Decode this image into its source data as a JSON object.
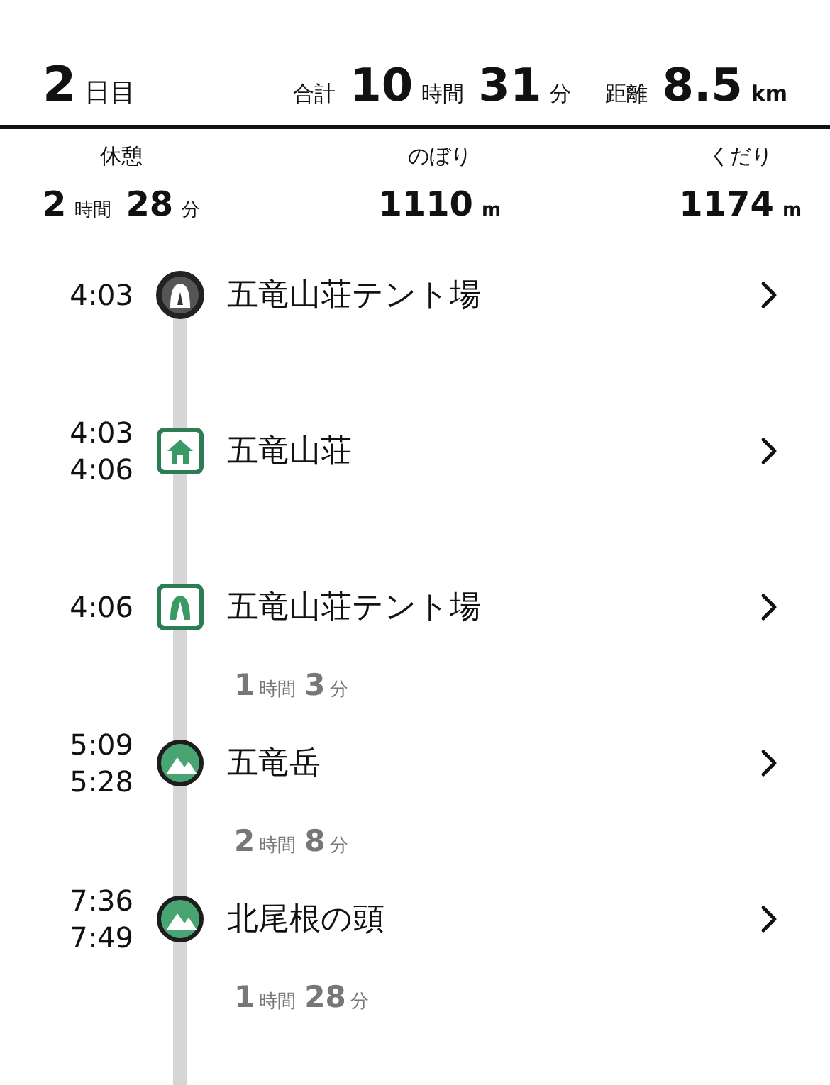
{
  "header": {
    "day": {
      "number": "2",
      "unit": "日目"
    },
    "total": {
      "label": "合計",
      "parts": [
        {
          "value": "10",
          "unit": "時間"
        },
        {
          "value": "31",
          "unit": "分"
        }
      ]
    },
    "distance": {
      "label": "距離",
      "parts": [
        {
          "value": "8.5",
          "unit": "km"
        }
      ]
    }
  },
  "stats": [
    {
      "label": "休憩",
      "parts": [
        {
          "value": "2",
          "unit": "時間"
        },
        {
          "value": "28",
          "unit": "分"
        }
      ]
    },
    {
      "label": "のぼり",
      "parts": [
        {
          "value": "1110",
          "unit": "m"
        }
      ]
    },
    {
      "label": "くだり",
      "parts": [
        {
          "value": "1174",
          "unit": "m"
        }
      ]
    }
  ],
  "stops": [
    {
      "kind": "start-tent",
      "times": [
        "4:03"
      ],
      "name": "五竜山荘テント場"
    },
    {
      "kind": "hut",
      "times": [
        "4:03",
        "4:06"
      ],
      "name": "五竜山荘"
    },
    {
      "kind": "tent",
      "times": [
        "4:06"
      ],
      "name": "五竜山荘テント場",
      "duration_after": [
        {
          "value": "1",
          "unit": "時間"
        },
        {
          "value": "3",
          "unit": "分"
        }
      ]
    },
    {
      "kind": "peak",
      "times": [
        "5:09",
        "5:28"
      ],
      "name": "五竜岳",
      "duration_after": [
        {
          "value": "2",
          "unit": "時間"
        },
        {
          "value": "8",
          "unit": "分"
        }
      ]
    },
    {
      "kind": "peak",
      "times": [
        "7:36",
        "7:49"
      ],
      "name": "北尾根の頭",
      "duration_after": [
        {
          "value": "1",
          "unit": "時間"
        },
        {
          "value": "28",
          "unit": "分"
        }
      ]
    }
  ]
}
